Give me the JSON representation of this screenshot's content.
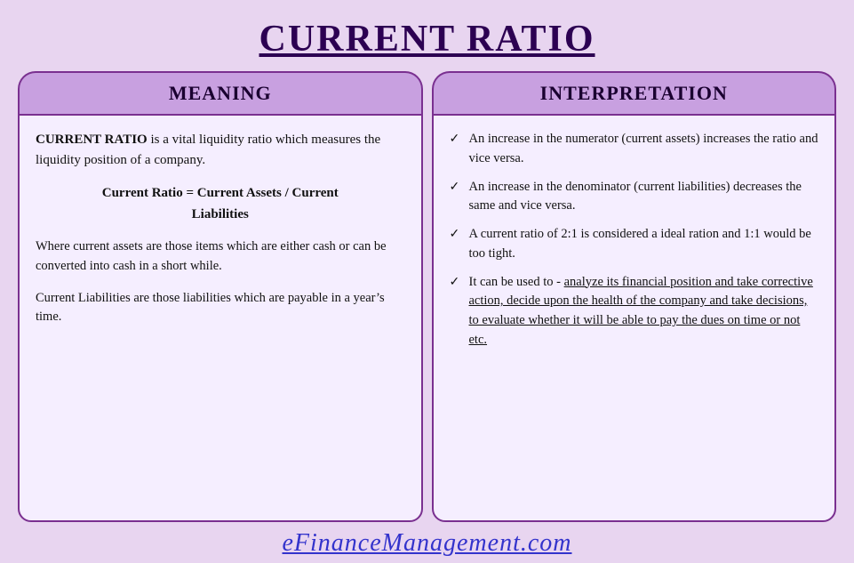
{
  "title": "CURRENT RATIO",
  "meaning": {
    "header": "MEANING",
    "intro_bold": "CURRENT RATIO",
    "intro_rest": " is a vital liquidity ratio which measures the liquidity position of a company.",
    "formula_line1": "Current Ratio  =  Current Assets /  Current",
    "formula_line2": "Liabilities",
    "where_text": "Where current assets are those items which are either cash or can be converted into cash in a short while.",
    "liabilities_text": "Current Liabilities are those liabilities which are payable in a year’s time."
  },
  "interpretation": {
    "header": "INTERPRETATION",
    "items": [
      {
        "text": "An increase in the numerator (current assets) increases the ratio and vice versa.",
        "underline": false
      },
      {
        "text": "An increase in the denominator (current liabilities) decreases the same and vice versa.",
        "underline": false
      },
      {
        "text": "A current ratio of 2:1 is considered a ideal ration and 1:1 would be too tight.",
        "underline": false
      },
      {
        "text_plain": "It can be used to - ",
        "text_underlined": "analyze its financial position and take corrective action, decide upon the health of the company and take decisions, to evaluate whether it will be able to pay the dues on time or not etc.",
        "underline": true
      }
    ]
  },
  "footer": "eFinanceManagement.com"
}
